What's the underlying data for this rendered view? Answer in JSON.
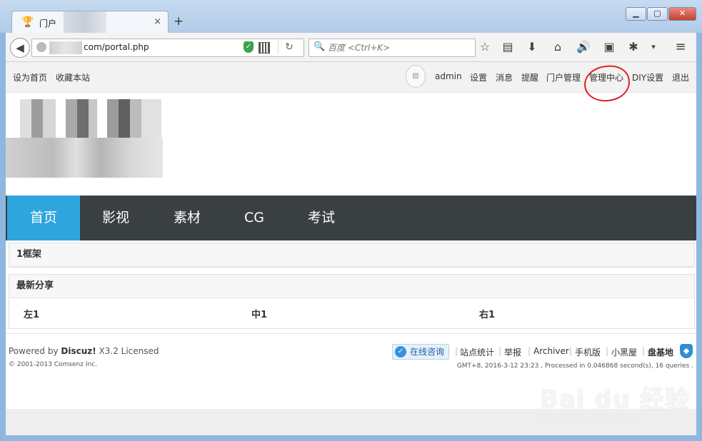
{
  "browser": {
    "tab_title": "门户",
    "new_tab": "+",
    "tab_close": "×",
    "url": "com/portal.php",
    "search_placeholder": "百度 <Ctrl+K>",
    "window_buttons": {
      "minimize": "▁",
      "maximize": "▢",
      "close": "✕"
    }
  },
  "topbar": {
    "left_links": [
      "设为首页",
      "收藏本站"
    ],
    "user": "admin",
    "right_links": [
      "设置",
      "消息",
      "提醒",
      "门户管理",
      "管理中心",
      "DIY设置",
      "退出"
    ]
  },
  "mainnav": {
    "items": [
      "首页",
      "影视",
      "素材",
      "CG",
      "考试"
    ],
    "active_index": 0
  },
  "frame_box": {
    "title": "1框架"
  },
  "share_box": {
    "title": "最新分享",
    "columns": [
      "左1",
      "中1",
      "右1"
    ]
  },
  "footer": {
    "powered_prefix": "Powered by ",
    "powered_brand": "Discuz!",
    "powered_suffix": " X3.2 Licensed",
    "copyright": "© 2001-2013 Comsenz Inc.",
    "online": "在线咨询",
    "links": [
      "站点统计",
      "举报",
      "Archiver",
      "手机版",
      "小黑屋",
      "盘基地"
    ],
    "gmt": "GMT+8, 2016-3-12 23:23 , Processed in 0.046868 second(s), 16 queries ."
  },
  "watermark": {
    "brand": "Bai du 经验",
    "domain": "jingyan.baidu.com"
  },
  "colors": {
    "nav_bg": "#3a3f42",
    "nav_active": "#2fa5de",
    "annotation": "#e02020"
  }
}
